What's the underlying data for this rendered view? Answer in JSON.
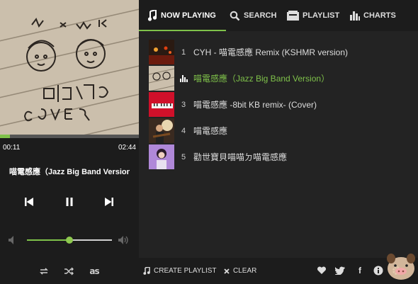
{
  "player": {
    "elapsed": "00:11",
    "duration": "02:44",
    "progress_fraction": 0.07,
    "song_title": "喵電感應（Jazz Big Band Version）",
    "volume_fraction": 0.5,
    "colors": {
      "accent": "#7fc24a",
      "background": "#1c1c1c"
    }
  },
  "tabs": [
    {
      "label": "NOW PLAYING",
      "icon": "music-note-icon",
      "active": true
    },
    {
      "label": "SEARCH",
      "icon": "search-icon",
      "active": false
    },
    {
      "label": "PLAYLIST",
      "icon": "playlist-icon",
      "active": false
    },
    {
      "label": "CHARTS",
      "icon": "bar-chart-icon",
      "active": false
    }
  ],
  "playlist": [
    {
      "num": "1",
      "title": "CYH - 喵電感應 Remix (KSHMR version)",
      "active": false
    },
    {
      "num": "2",
      "title": "喵電感應（Jazz Big Band Version）",
      "active": true
    },
    {
      "num": "3",
      "title": "喵電感應 -8bit KB remix- (Cover)",
      "active": false
    },
    {
      "num": "4",
      "title": "喵電感應",
      "active": false
    },
    {
      "num": "5",
      "title": "勸世寶貝喵喵ㄉ喵電感應",
      "active": false
    }
  ],
  "footer": {
    "create_playlist": "CREATE PLAYLIST",
    "clear": "CLEAR",
    "social_icons": [
      "heart-icon",
      "twitter-icon",
      "facebook-icon",
      "info-icon",
      "settings-icon"
    ]
  }
}
